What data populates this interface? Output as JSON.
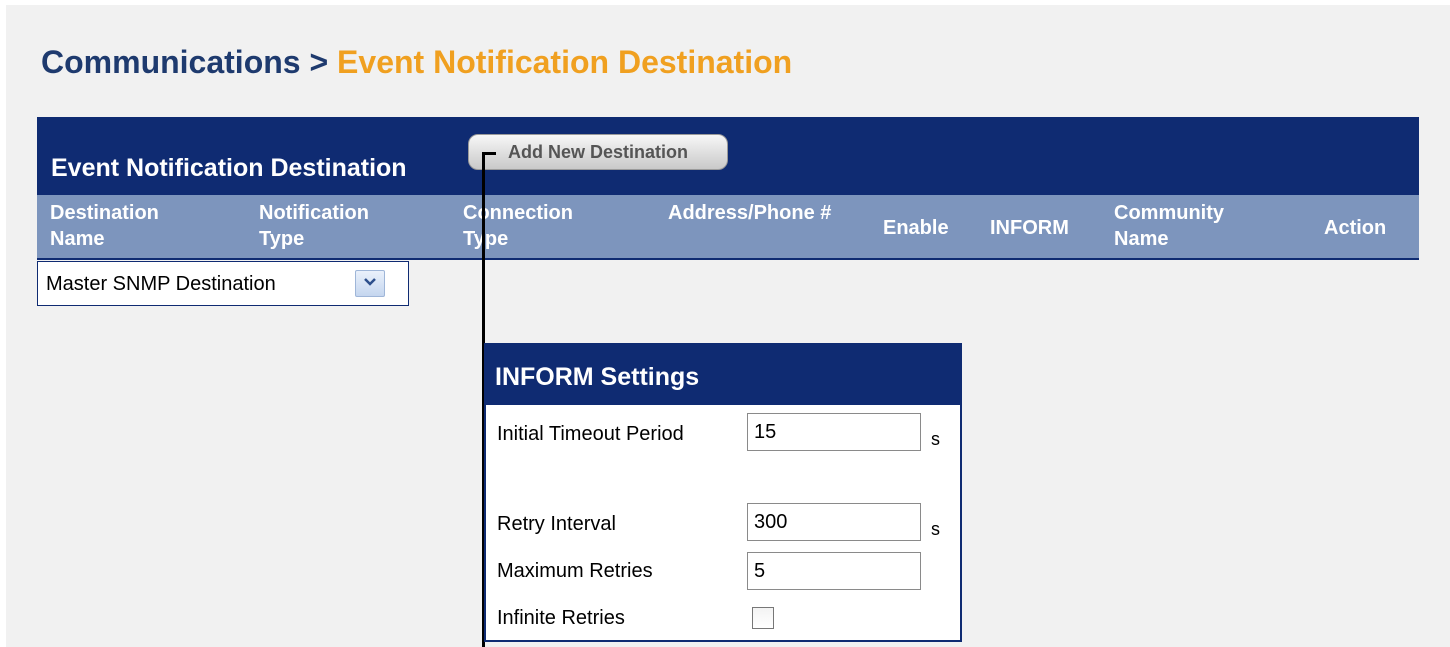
{
  "breadcrumb": {
    "parent": "Communications",
    "separator": ">",
    "current": "Event Notification Destination"
  },
  "destination_table": {
    "title": "Event Notification Destination",
    "add_button_label": "Add New Destination",
    "columns": [
      "Destination Name",
      "Notification Type",
      "Connection Type",
      "Address/Phone #",
      "Enable",
      "INFORM",
      "Community Name",
      "Action"
    ],
    "destination_select": {
      "selected": "Master SNMP Destination"
    }
  },
  "inform_settings": {
    "title": "INFORM Settings",
    "initial_timeout": {
      "label": "Initial Timeout Period",
      "value": "15",
      "unit": "s"
    },
    "retry_interval": {
      "label": "Retry Interval",
      "value": "300",
      "unit": "s"
    },
    "maximum_retries": {
      "label": "Maximum Retries",
      "value": "5"
    },
    "infinite_retries": {
      "label": "Infinite Retries",
      "checked": false
    }
  },
  "colors": {
    "header_navy": "#0f2b72",
    "column_header": "#7d95bd",
    "breadcrumb_accent": "#f0a020",
    "breadcrumb_parent": "#1e3a6e"
  }
}
